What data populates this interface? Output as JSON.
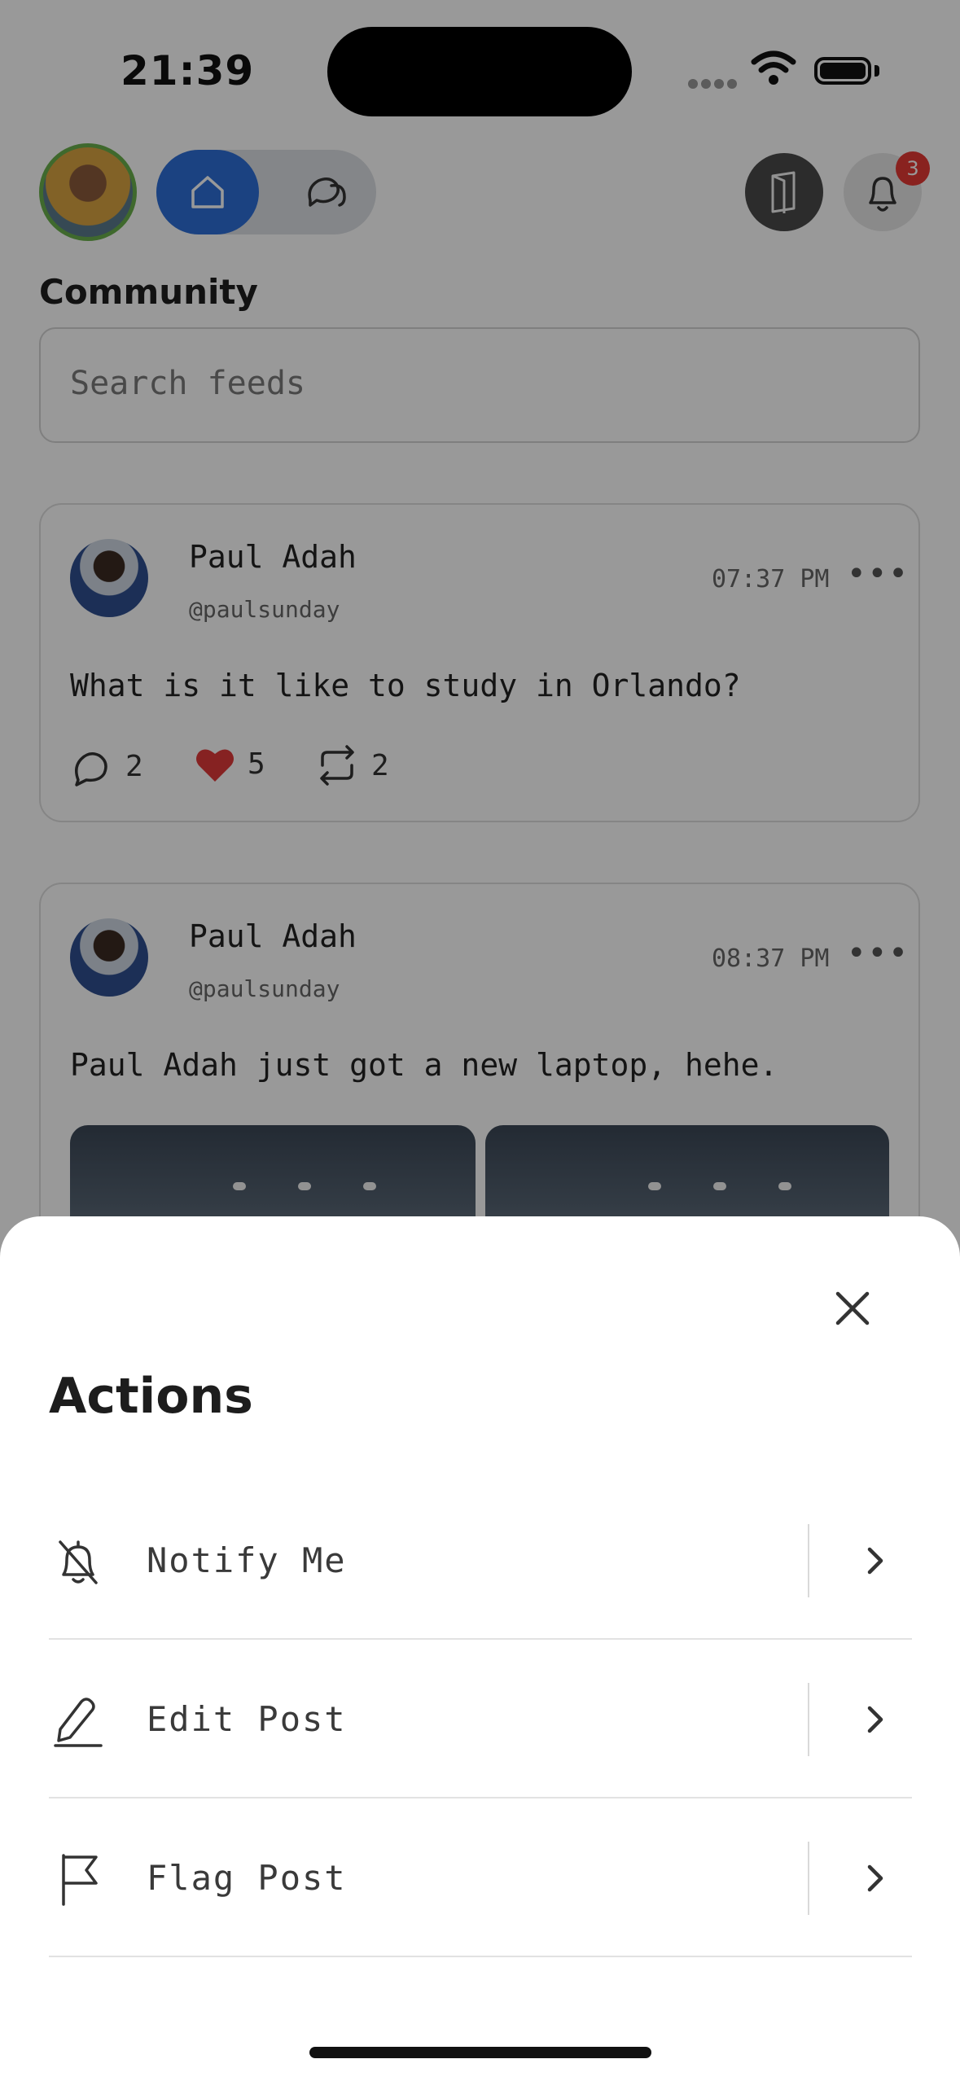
{
  "status_bar": {
    "time": "21:39"
  },
  "header": {
    "notification_count": "3",
    "section_title": "Community"
  },
  "search": {
    "placeholder": "Search feeds",
    "value": ""
  },
  "posts": [
    {
      "author": "Paul Adah",
      "handle": "@paulsunday",
      "time": "07:37 PM",
      "text": "What is it like to study in Orlando?",
      "comments": "2",
      "likes": "5",
      "reposts": "2"
    },
    {
      "author": "Paul Adah",
      "handle": "@paulsunday",
      "time": "08:37 PM",
      "text": "Paul Adah just got a new laptop, hehe."
    }
  ],
  "sheet": {
    "title": "Actions",
    "actions": [
      {
        "label": "Notify Me",
        "icon": "bell-off-icon"
      },
      {
        "label": "Edit Post",
        "icon": "pencil-icon"
      },
      {
        "label": "Flag Post",
        "icon": "flag-icon"
      }
    ]
  },
  "colors": {
    "accent": "#2d6fd8",
    "badge": "#e53935",
    "like": "#e03a3a",
    "avatar_ring": "#6ab04c"
  }
}
